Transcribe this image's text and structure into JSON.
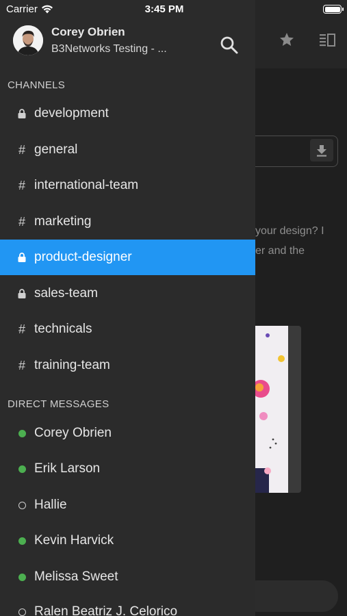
{
  "status_bar": {
    "carrier": "Carrier",
    "time": "3:45 PM"
  },
  "profile": {
    "name": "Corey Obrien",
    "workspace": "B3Networks Testing - ..."
  },
  "channels": {
    "header": "CHANNELS",
    "items": [
      {
        "label": "development",
        "icon": "lock-icon",
        "active": false
      },
      {
        "label": "general",
        "icon": "hash-icon",
        "active": false
      },
      {
        "label": "international-team",
        "icon": "hash-icon",
        "active": false
      },
      {
        "label": "marketing",
        "icon": "hash-icon",
        "active": false
      },
      {
        "label": "product-designer",
        "icon": "lock-icon",
        "active": true
      },
      {
        "label": "sales-team",
        "icon": "lock-icon",
        "active": false
      },
      {
        "label": "technicals",
        "icon": "hash-icon",
        "active": false
      },
      {
        "label": "training-team",
        "icon": "hash-icon",
        "active": false
      }
    ]
  },
  "direct_messages": {
    "header": "DIRECT MESSAGES",
    "items": [
      {
        "label": "Corey Obrien",
        "status": "online"
      },
      {
        "label": "Erik Larson",
        "status": "online"
      },
      {
        "label": "Hallie",
        "status": "offline"
      },
      {
        "label": "Kevin Harvick",
        "status": "online"
      },
      {
        "label": "Melissa Sweet",
        "status": "online"
      },
      {
        "label": "Ralen Beatriz J. Celorico",
        "status": "offline"
      }
    ]
  },
  "background": {
    "message_line_1": "your design? I",
    "message_line_2": "er and the"
  },
  "colors": {
    "accent": "#2196f3",
    "online": "#4caf50",
    "drawer_bg": "#2b2b2b"
  }
}
